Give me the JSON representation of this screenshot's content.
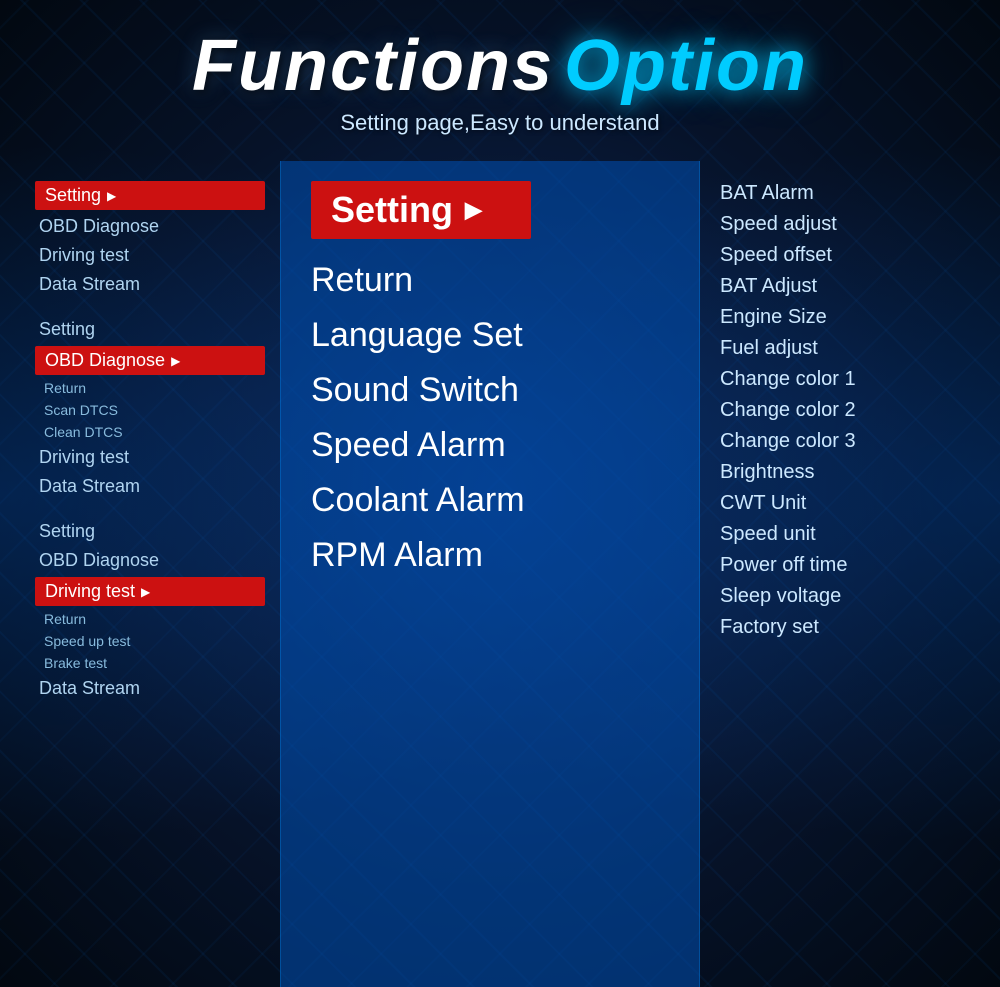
{
  "header": {
    "title_functions": "Functions",
    "title_option": "Option",
    "subtitle": "Setting page,Easy to understand"
  },
  "left_panel": {
    "groups": [
      {
        "items": [
          {
            "label": "Setting",
            "active": true,
            "level": "main"
          },
          {
            "label": "OBD Diagnose",
            "active": false,
            "level": "main"
          },
          {
            "label": "Driving test",
            "active": false,
            "level": "main"
          },
          {
            "label": "Data Stream",
            "active": false,
            "level": "main"
          }
        ]
      },
      {
        "items": [
          {
            "label": "Setting",
            "active": false,
            "level": "main"
          },
          {
            "label": "OBD Diagnose",
            "active": true,
            "level": "main"
          },
          {
            "label": "Return",
            "active": false,
            "level": "sub"
          },
          {
            "label": "Scan DTCS",
            "active": false,
            "level": "sub"
          },
          {
            "label": "Clean DTCS",
            "active": false,
            "level": "sub"
          },
          {
            "label": "Driving test",
            "active": false,
            "level": "main"
          },
          {
            "label": "Data Stream",
            "active": false,
            "level": "main"
          }
        ]
      },
      {
        "items": [
          {
            "label": "Setting",
            "active": false,
            "level": "main"
          },
          {
            "label": "OBD Diagnose",
            "active": false,
            "level": "main"
          },
          {
            "label": "Driving test",
            "active": true,
            "level": "main"
          },
          {
            "label": "Return",
            "active": false,
            "level": "sub"
          },
          {
            "label": "Speed up test",
            "active": false,
            "level": "sub"
          },
          {
            "label": "Brake test",
            "active": false,
            "level": "sub"
          },
          {
            "label": "Data Stream",
            "active": false,
            "level": "main"
          }
        ]
      }
    ]
  },
  "center_panel": {
    "title": "Setting",
    "items": [
      "Return",
      "Language Set",
      "Sound Switch",
      "Speed Alarm",
      "Coolant Alarm",
      "RPM Alarm"
    ]
  },
  "right_panel": {
    "items": [
      "BAT Alarm",
      "Speed adjust",
      "Speed offset",
      "BAT Adjust",
      "Engine Size",
      "Fuel adjust",
      "Change color 1",
      "Change color 2",
      "Change color 3",
      "Brightness",
      "CWT Unit",
      "Speed unit",
      "Power off time",
      "Sleep voltage",
      "Factory set"
    ]
  }
}
